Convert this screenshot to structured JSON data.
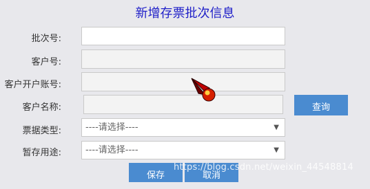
{
  "form": {
    "title": "新增存票批次信息",
    "fields": [
      {
        "label": "批次号:",
        "value": ""
      },
      {
        "label": "客户号:",
        "value": ""
      },
      {
        "label": "客户开户账号:",
        "value": ""
      },
      {
        "label": "客户名称:",
        "value": ""
      }
    ],
    "selects": [
      {
        "label": "票据类型:",
        "selected": "----请选择----"
      },
      {
        "label": "暂存用途:",
        "selected": "----请选择----"
      }
    ],
    "query_label": "查询",
    "save_label": "保存",
    "cancel_label": "取消"
  },
  "watermark": "https://blog.csdn.net/weixin_44548814"
}
